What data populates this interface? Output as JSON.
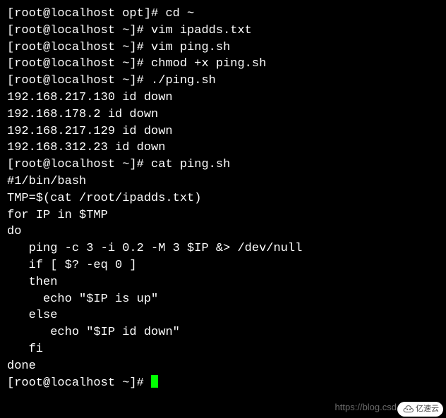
{
  "terminal": {
    "lines": [
      {
        "prompt": "[root@localhost opt]# ",
        "command": "cd ~"
      },
      {
        "prompt": "[root@localhost ~]# ",
        "command": "vim ipadds.txt"
      },
      {
        "prompt": "[root@localhost ~]# ",
        "command": "vim ping.sh"
      },
      {
        "prompt": "[root@localhost ~]# ",
        "command": "chmod +x ping.sh"
      },
      {
        "prompt": "[root@localhost ~]# ",
        "command": "./ping.sh"
      },
      {
        "output": "192.168.217.130 id down"
      },
      {
        "output": "192.168.178.2 id down"
      },
      {
        "output": "192.168.217.129 id down"
      },
      {
        "output": "192.168.312.23 id down"
      },
      {
        "prompt": "[root@localhost ~]# ",
        "command": "cat ping.sh"
      },
      {
        "output": "#1/bin/bash"
      },
      {
        "output": "TMP=$(cat /root/ipadds.txt)"
      },
      {
        "output": "for IP in $TMP"
      },
      {
        "output": "do"
      },
      {
        "output": "   ping -c 3 -i 0.2 -M 3 $IP &> /dev/null"
      },
      {
        "output": "   if [ $? -eq 0 ]"
      },
      {
        "output": "   then"
      },
      {
        "output": "     echo \"$IP is up\""
      },
      {
        "output": "   else"
      },
      {
        "output": "      echo \"$IP id down\""
      },
      {
        "output": "   fi"
      },
      {
        "output": "done"
      },
      {
        "prompt": "[root@localhost ~]# ",
        "command": "",
        "cursor": true
      }
    ]
  },
  "watermark": {
    "text": "https://blog.csd"
  },
  "logo": {
    "text": "亿速云"
  }
}
